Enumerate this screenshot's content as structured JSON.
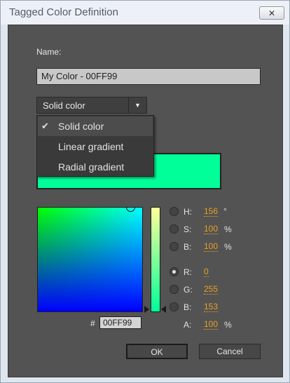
{
  "dialog": {
    "title": "Tagged Color Definition",
    "close_glyph": "✕"
  },
  "name_field": {
    "label": "Name:",
    "value": "My Color - 00FF99"
  },
  "type_dropdown": {
    "selected": "Solid color",
    "arrow": "▼",
    "options": [
      {
        "label": "Solid color",
        "checked": true
      },
      {
        "label": "Linear gradient",
        "checked": false
      },
      {
        "label": "Radial gradient",
        "checked": false
      }
    ],
    "check_glyph": "✔"
  },
  "color": {
    "preview_hex": "#00FF99",
    "hex_prefix": "#",
    "hex_value": "00FF99"
  },
  "channels": [
    {
      "label": "H:",
      "value": "156",
      "unit": "°",
      "selected": false
    },
    {
      "label": "S:",
      "value": "100",
      "unit": "%",
      "selected": false
    },
    {
      "label": "B:",
      "value": "100",
      "unit": "%",
      "selected": false
    },
    {
      "label": "R:",
      "value": "0",
      "unit": "",
      "selected": true
    },
    {
      "label": "G:",
      "value": "255",
      "unit": "",
      "selected": false
    },
    {
      "label": "B:",
      "value": "153",
      "unit": "",
      "selected": false
    }
  ],
  "alpha": {
    "label": "A:",
    "value": "100",
    "unit": "%"
  },
  "buttons": {
    "ok": "OK",
    "cancel": "Cancel"
  }
}
